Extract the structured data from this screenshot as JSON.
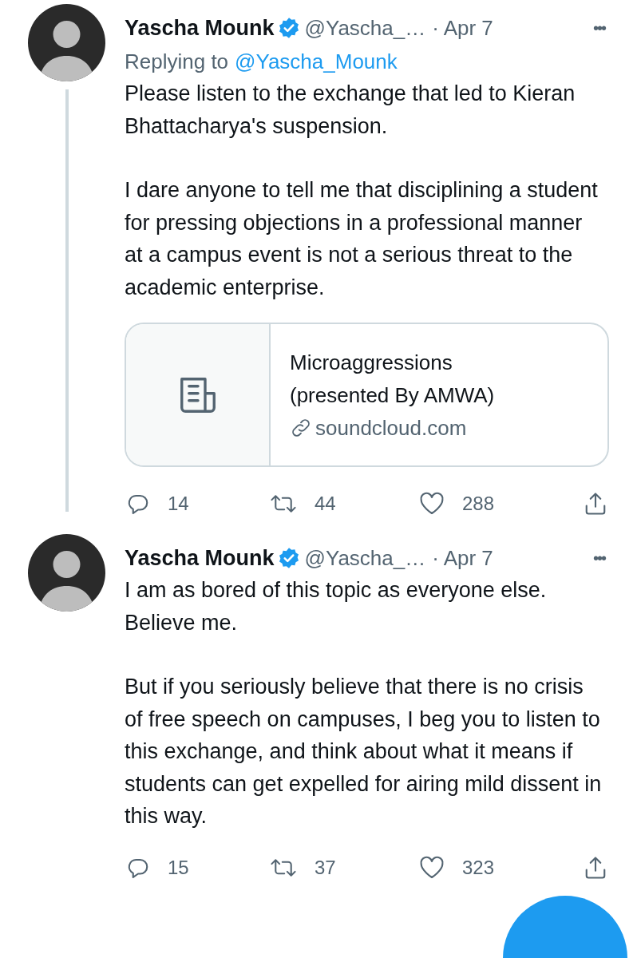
{
  "tweets": [
    {
      "name": "Yascha Mounk",
      "verified": true,
      "handle": "@Yascha_…",
      "date": "· Apr 7",
      "more": "•••",
      "thread_line": true,
      "replying_label": "Replying to",
      "replying_to": "@Yascha_Mounk",
      "paragraphs": [
        "Please listen to the exchange that led to Kieran Bhattacharya's suspension.",
        "I dare anyone to tell me that disciplining a student for pressing objections in a professional manner at a campus event is not a serious threat to the academic enterprise."
      ],
      "card": {
        "title": "Microaggressions (presented By AMWA)",
        "domain": "soundcloud.com"
      },
      "stats": {
        "replies": "14",
        "retweets": "44",
        "likes": "288"
      }
    },
    {
      "name": "Yascha Mounk",
      "verified": true,
      "handle": "@Yascha_…",
      "date": "· Apr 7",
      "more": "•••",
      "thread_line": false,
      "paragraphs": [
        "I am as bored of this topic as everyone else. Believe me.",
        "But if you seriously believe that there is no crisis of free speech on campuses, I beg you to listen to this exchange, and think about what it means if students can get expelled for airing mild dissent in this way."
      ],
      "stats": {
        "replies": "15",
        "retweets": "37",
        "likes": "323"
      }
    }
  ]
}
